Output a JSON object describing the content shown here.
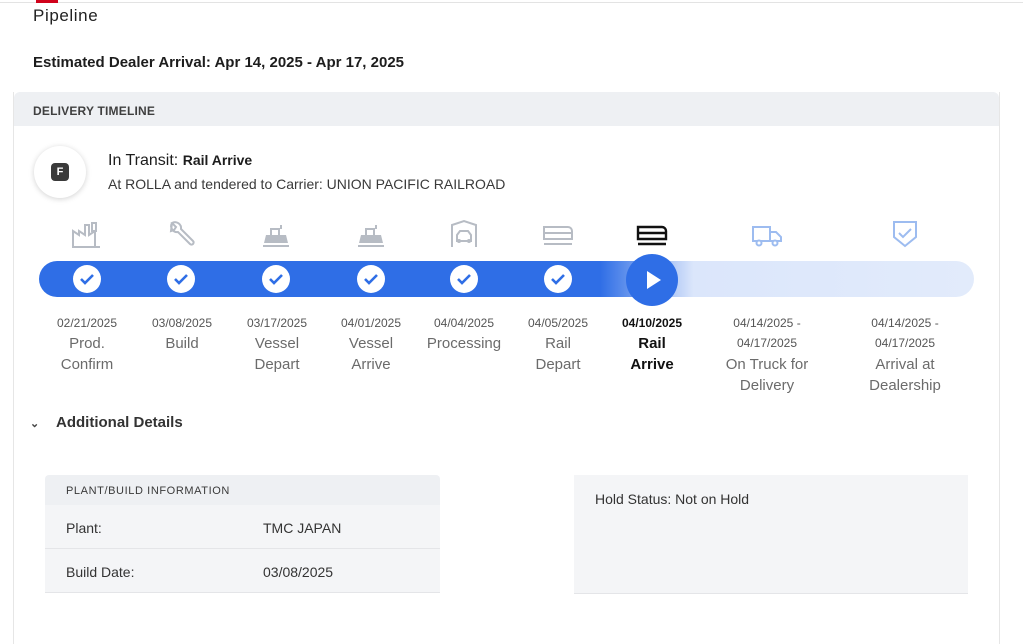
{
  "page": {
    "title": "Pipeline",
    "eta": "Estimated Dealer Arrival: Apr 14, 2025 - Apr 17, 2025"
  },
  "timeline": {
    "header": "DELIVERY TIMELINE",
    "status_chip": "F",
    "status_label": "In Transit:",
    "status_value": "Rail Arrive",
    "status_detail": "At ROLLA and tendered to Carrier: UNION PACIFIC RAILROAD",
    "stages": [
      {
        "date": "02/21/2025",
        "label": "Prod. Confirm",
        "icon": "factory-icon",
        "state": "done"
      },
      {
        "date": "03/08/2025",
        "label": "Build",
        "icon": "wrench-icon",
        "state": "done"
      },
      {
        "date": "03/17/2025",
        "label": "Vessel Depart",
        "icon": "vessel-depart-icon",
        "state": "done"
      },
      {
        "date": "04/01/2025",
        "label": "Vessel Arrive",
        "icon": "vessel-arrive-icon",
        "state": "done"
      },
      {
        "date": "04/04/2025",
        "label": "Processing",
        "icon": "processing-icon",
        "state": "done"
      },
      {
        "date": "04/05/2025",
        "label": "Rail Depart",
        "icon": "rail-depart-icon",
        "state": "done"
      },
      {
        "date": "04/10/2025",
        "label": "Rail Arrive",
        "icon": "rail-arrive-icon",
        "state": "current"
      },
      {
        "date": "04/14/2025 - 04/17/2025",
        "label": "On Truck for Delivery",
        "icon": "truck-icon",
        "state": "pending"
      },
      {
        "date": "04/14/2025 - 04/17/2025",
        "label": "Arrival at Dealership",
        "icon": "shield-check-icon",
        "state": "pending"
      }
    ]
  },
  "additional_details": {
    "label": "Additional Details",
    "plant_build": {
      "header": "PLANT/BUILD INFORMATION",
      "rows": [
        {
          "key": "Plant:",
          "value": "TMC JAPAN"
        },
        {
          "key": "Build Date:",
          "value": "03/08/2025"
        }
      ]
    },
    "hold_status": "Hold Status: Not on Hold"
  },
  "colors": {
    "accent": "#2f6ee6",
    "brand_red": "#d0021b",
    "icon_done": "#b7bcc4",
    "icon_pending": "#9dbcf0"
  }
}
